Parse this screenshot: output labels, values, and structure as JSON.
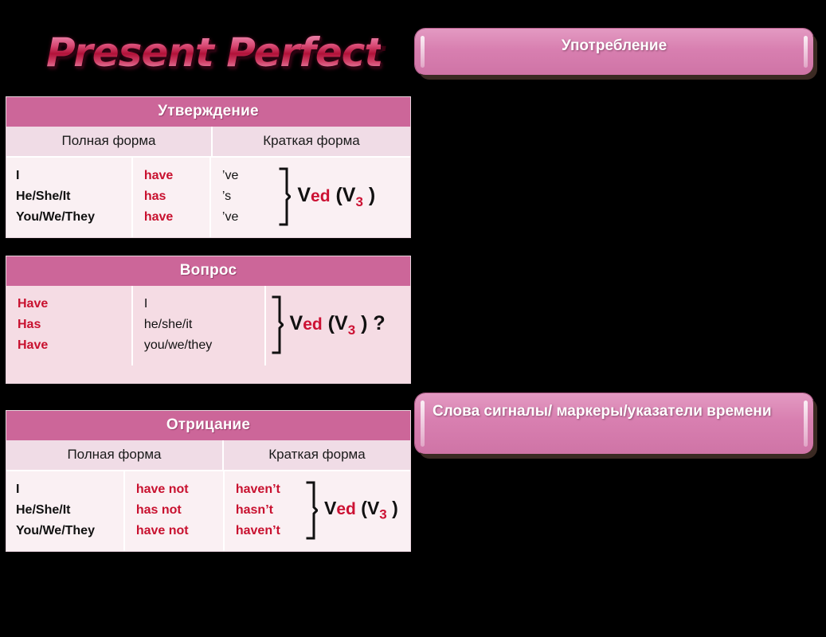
{
  "slide": {
    "title": "Present Perfect",
    "background": "#000000",
    "accent_pink": "#cc6699",
    "accent_red": "#cc1133"
  },
  "tables": [
    {
      "name": "affirmative",
      "header": "Утверждение",
      "subheaders": [
        "Полная форма",
        "Краткая форма"
      ],
      "pronouns": [
        "I",
        "He/She/It",
        "You/We/They"
      ],
      "full_forms": [
        "have",
        "has",
        "have"
      ],
      "short_forms": [
        "’ve",
        "’s",
        "’ve"
      ],
      "formula": {
        "v": "V",
        "ed": "ed",
        "open": " (V",
        "sub": "3",
        "close": " )",
        "tail": ""
      }
    },
    {
      "name": "question",
      "header": "Вопрос",
      "subheaders": [],
      "auxiliaries": [
        "Have",
        "Has",
        "Have"
      ],
      "pronouns": [
        "I",
        "he/she/it",
        "you/we/they"
      ],
      "formula": {
        "v": "V",
        "ed": "ed",
        "open": " (V",
        "sub": "3",
        "close": " )",
        "tail": " ?"
      }
    },
    {
      "name": "negative",
      "header": "Отрицание",
      "subheaders": [
        "Полная форма",
        "Краткая форма"
      ],
      "pronouns": [
        "I",
        "He/She/It",
        "You/We/They"
      ],
      "full_forms": [
        "have not",
        "has not",
        "have not"
      ],
      "short_forms": [
        "haven’t",
        "hasn’t",
        "haven’t"
      ],
      "formula": {
        "v": "V",
        "ed": "ed",
        "open": " (V",
        "sub": "3",
        "close": " )",
        "tail": ""
      }
    }
  ],
  "right_panel": {
    "usage_banner": "Употребление",
    "markers_banner": "Слова сигналы/ маркеры/указатели времени",
    "usage_lines": [
      "",
      "",
      "",
      "",
      "",
      "",
      "",
      "",
      "",
      "",
      "",
      ""
    ],
    "markers_lines": [
      "",
      "",
      "",
      ""
    ]
  }
}
